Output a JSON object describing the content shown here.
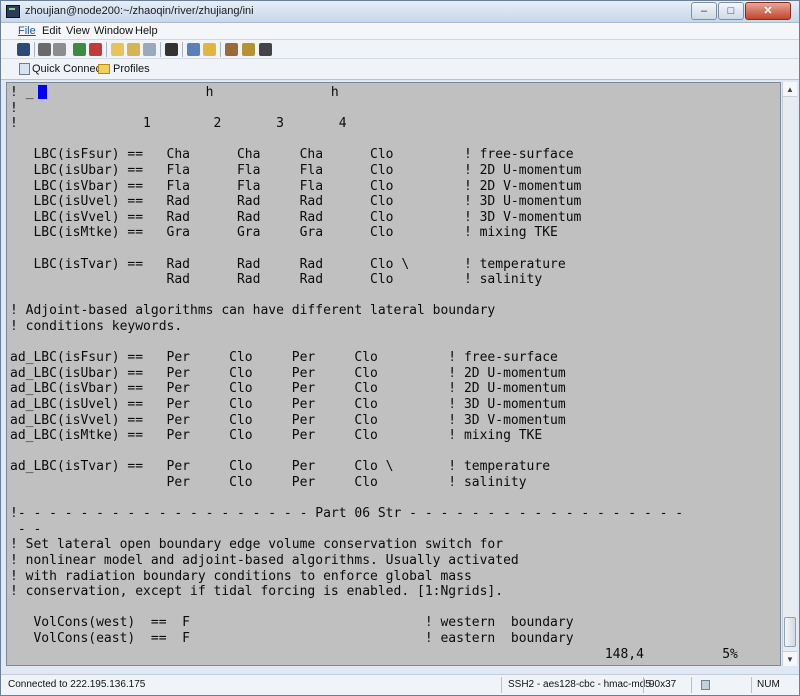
{
  "window": {
    "title": "zhoujian@node200:~/zhaoqin/river/zhujiang/ini",
    "minimize": "–",
    "maximize": "□",
    "close": "✕"
  },
  "menu": {
    "file": "File",
    "edit": "Edit",
    "view": "View",
    "window": "Window",
    "help": "Help"
  },
  "toolbar": {
    "icons": [
      "save-icon",
      "print-icon",
      "print-preview-icon",
      "new-connection-icon",
      "disconnect-icon",
      "copy-icon",
      "paste-icon",
      "select-all-icon",
      "find-icon",
      "file-transfer-icon",
      "settings-icon",
      "sftp-icon",
      "keygen-icon",
      "help-icon"
    ],
    "quick_connect": "Quick Connect",
    "profiles": "Profiles"
  },
  "terminal": {
    "lines": [
      "! _                      h               h",
      "!",
      "!                1        2       3       4",
      "",
      "   LBC(isFsur) ==   Cha      Cha     Cha      Clo         ! free-surface",
      "   LBC(isUbar) ==   Fla      Fla     Fla      Clo         ! 2D U-momentum",
      "   LBC(isVbar) ==   Fla      Fla     Fla      Clo         ! 2D V-momentum",
      "   LBC(isUvel) ==   Rad      Rad     Rad      Clo         ! 3D U-momentum",
      "   LBC(isVvel) ==   Rad      Rad     Rad      Clo         ! 3D V-momentum",
      "   LBC(isMtke) ==   Gra      Gra     Gra      Clo         ! mixing TKE",
      "",
      "   LBC(isTvar) ==   Rad      Rad     Rad      Clo \\       ! temperature",
      "                    Rad      Rad     Rad      Clo         ! salinity",
      "",
      "! Adjoint-based algorithms can have different lateral boundary",
      "! conditions keywords.",
      "",
      "ad_LBC(isFsur) ==   Per     Clo     Per     Clo         ! free-surface",
      "ad_LBC(isUbar) ==   Per     Clo     Per     Clo         ! 2D U-momentum",
      "ad_LBC(isVbar) ==   Per     Clo     Per     Clo         ! 2D U-momentum",
      "ad_LBC(isUvel) ==   Per     Clo     Per     Clo         ! 3D U-momentum",
      "ad_LBC(isVvel) ==   Per     Clo     Per     Clo         ! 3D V-momentum",
      "ad_LBC(isMtke) ==   Per     Clo     Per     Clo         ! mixing TKE",
      "",
      "ad_LBC(isTvar) ==   Per     Clo     Per     Clo \\       ! temperature",
      "                    Per     Clo     Per     Clo         ! salinity",
      "",
      "!- - - - - - - - - - - - - - - - - - - Part 06 Str - - - - - - - - - - - - - - - - - -",
      " - -",
      "! Set lateral open boundary edge volume conservation switch for",
      "! nonlinear model and adjoint-based algorithms. Usually activated",
      "! with radiation boundary conditions to enforce global mass",
      "! conservation, except if tidal forcing is enabled. [1:Ngrids].",
      "",
      "   VolCons(west)  ==  F                              ! western  boundary",
      "   VolCons(east)  ==  F                              ! eastern  boundary",
      "                                                                            148,4          5%"
    ]
  },
  "status": {
    "connection": "Connected to 222.195.136.175",
    "cipher": "SSH2 - aes128-cbc - hmac-md5",
    "size": "90x37",
    "num": "NUM"
  },
  "colors": {
    "terminal_bg": "#c0c0c0",
    "cursor": "#0000ff",
    "titlebar": "#c8d7ea"
  }
}
